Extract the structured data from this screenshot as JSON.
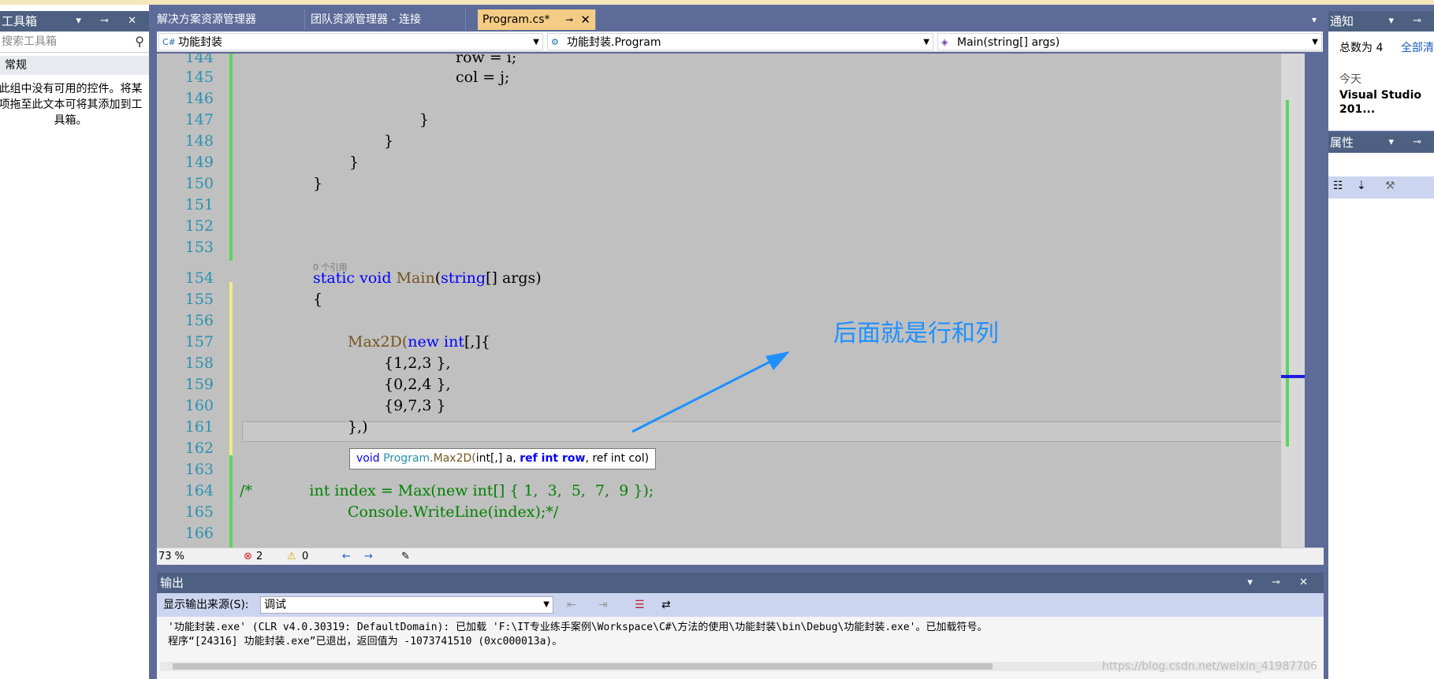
{
  "toolbox": {
    "title": "工具箱",
    "search_placeholder": "搜索工具箱",
    "group": "常规",
    "empty_text": "此组中没有可用的控件。将某项拖至此文本可将其添加到工具箱。",
    "buttons": "▾ ⊸ ✕"
  },
  "tabs": [
    {
      "label": "解决方案资源管理器"
    },
    {
      "label": "团队资源管理器 - 连接"
    },
    {
      "label": "Program.cs*"
    }
  ],
  "tab_close": "✕",
  "tab_pin": "⊸",
  "nav": {
    "project": "功能封装",
    "class": "功能封装.Program",
    "member": "Main(string[] args)"
  },
  "editor": {
    "line_numbers": [
      "144",
      "145",
      "146",
      "147",
      "148",
      "149",
      "150",
      "151",
      "152",
      "153",
      "154",
      "155",
      "156",
      "157",
      "158",
      "159",
      "160",
      "161",
      "162",
      "163",
      "164",
      "165",
      "166"
    ],
    "code": {
      "l144": "row = i;",
      "l145": "col = j;",
      "l147": "}",
      "l148": "}",
      "l149": "}",
      "l150": "}",
      "refs": "0 个引用",
      "l154_kw1": "static",
      "l154_kw2": "void",
      "l154_name": "Main",
      "l154_type": "string",
      "l154_rest": "[] args)",
      "l155": "{",
      "l157_call": "Max2D(",
      "l157_new": "new",
      "l157_int": "int",
      "l157_rest": "[,]{",
      "l158": "{1,2,3 },",
      "l159": "{0,2,4 },",
      "l160": "{9,7,3 }",
      "l161": "},)",
      "l164": "/*            int index = Max(new int[] { 1,  3,  5,  7,  9 });",
      "l165": "Console.WriteLine(index);*/"
    },
    "tooltip": {
      "void": "void",
      "cls": "Program",
      "method": ".Max2D(",
      "p1": "int[,] a, ",
      "p2": "ref int row",
      "p3": ", ref int col)"
    },
    "annotation": "后面就是行和列",
    "zoom": "73 %",
    "errors": "2",
    "warnings": "0"
  },
  "output": {
    "title": "输出",
    "source_label": "显示输出来源(S):",
    "source_value": "调试",
    "line1": "'功能封装.exe' (CLR v4.0.30319: DefaultDomain): 已加载 'F:\\IT专业练手案例\\Workspace\\C#\\方法的使用\\功能封装\\bin\\Debug\\功能封装.exe'。已加载符号。",
    "line2": "程序“[24316] 功能封装.exe”已退出，返回值为 -1073741510 (0xc000013a)。"
  },
  "notifications": {
    "title": "通知",
    "total": "总数为 4",
    "clear_all": "全部清",
    "today": "今天",
    "item": "Visual Studio 201..."
  },
  "properties": {
    "title": "属性"
  },
  "watermark": "https://blog.csdn.net/weixin_41987706",
  "colors": {
    "accent": "#4d6082",
    "active_tab": "#f5cc84",
    "annotation": "#1e90ff"
  }
}
